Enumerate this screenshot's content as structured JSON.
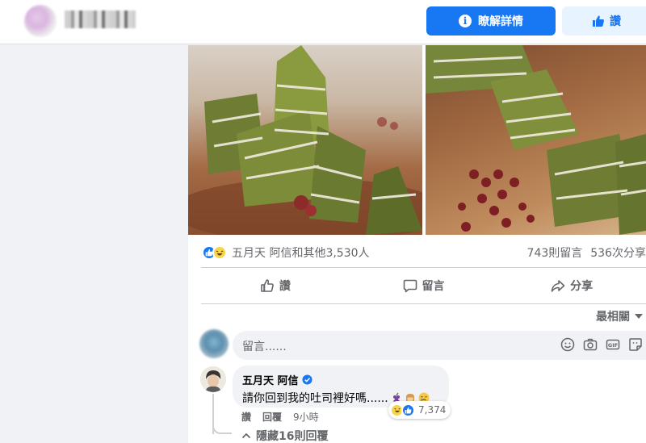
{
  "header": {
    "learn_more_label": "瞭解詳情",
    "like_page_label": "讚",
    "info_icon": "i"
  },
  "post": {
    "reaction_summary": "五月天 阿信和其他3,530人",
    "comments_count": "743則留言",
    "shares_count": "536次分享",
    "actions": {
      "like": "讚",
      "comment": "留言",
      "share": "分享"
    },
    "sort_label": "最相關"
  },
  "composer": {
    "placeholder": "留言......"
  },
  "comment": {
    "author": "五月天 阿信",
    "text": "請你回到我的吐司裡好嗎......",
    "reaction_count": "7,374",
    "like_label": "讚",
    "reply_label": "回覆",
    "time": "9小時",
    "hide_replies_label": "隱藏16則回覆"
  },
  "colors": {
    "brand": "#1877f2",
    "muted": "#65676b"
  }
}
